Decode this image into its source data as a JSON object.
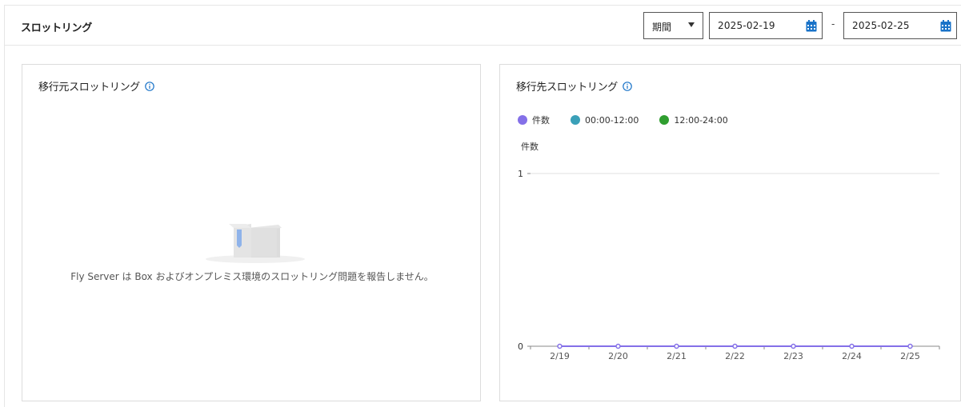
{
  "header": {
    "title": "スロットリング",
    "period_label": "期間",
    "date_start": "2025-02-19",
    "date_separator": "-",
    "date_end": "2025-02-25"
  },
  "source_panel": {
    "title": "移行元スロットリング",
    "empty_message": "Fly Server は Box およびオンプレミス環境のスロットリング問題を報告しません。"
  },
  "target_panel": {
    "title": "移行先スロットリング"
  },
  "colors": {
    "count": "#8470e8",
    "am": "#3aa0b8",
    "pm": "#2f9e2f",
    "accent": "#1a73c8"
  },
  "chart_data": {
    "type": "line",
    "ylabel": "件数",
    "ylim": [
      0,
      1
    ],
    "yticks": [
      "0",
      "1"
    ],
    "categories": [
      "2/19",
      "2/20",
      "2/21",
      "2/22",
      "2/23",
      "2/24",
      "2/25"
    ],
    "series": [
      {
        "name": "件数",
        "values": [
          0,
          0,
          0,
          0,
          0,
          0,
          0
        ]
      },
      {
        "name": "00:00-12:00",
        "values": []
      },
      {
        "name": "12:00-24:00",
        "values": []
      }
    ],
    "legend_position": "top-left",
    "grid": true
  }
}
